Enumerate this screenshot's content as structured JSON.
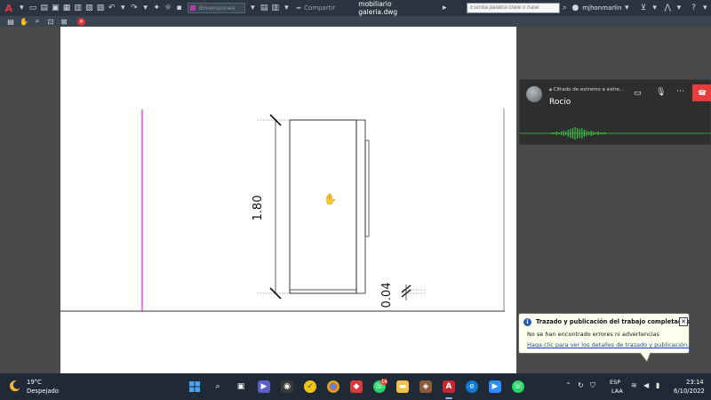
{
  "titlebar": {
    "app_logo": "A",
    "layer_combo": "dimensiones",
    "share_label": "Compartir",
    "document_title": "mobiliario galeria.dwg",
    "search_placeholder": "Escriba palabra clave o frase",
    "user_name": "mjhonmarlin"
  },
  "drawing": {
    "dimension_vertical": "1.80",
    "dimension_small": "0.04",
    "colors": {
      "magenta_line": "#ff33ff",
      "paper": "#ffffff",
      "ink": "#222222"
    }
  },
  "call_popup": {
    "encryption_label": "Cifrado de extremo a extre...",
    "caller_name": "Rocio",
    "colors": {
      "hangup": "#e83c3c",
      "wave": "#3fbf4a"
    }
  },
  "notification": {
    "title": "Trazado y publicación del trabajo completados",
    "message": "No se han encontrado errores ni advertencias",
    "link": "Haga clic para ver los detalles de trazado y publicación..."
  },
  "taskbar": {
    "weather_temp": "19°C",
    "weather_desc": "Despejado",
    "badge_count": "14",
    "language_1": "ESP",
    "language_2": "LAA",
    "time": "23:14",
    "date": "6/10/2022"
  }
}
